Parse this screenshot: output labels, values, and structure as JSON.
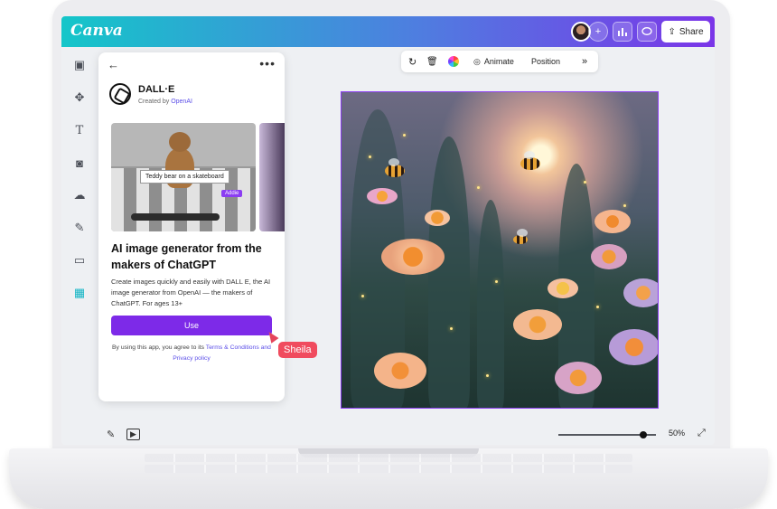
{
  "app": {
    "logo": "Canva"
  },
  "topbar": {
    "share_label": "Share",
    "buttons": [
      "add-icon",
      "analytics-icon",
      "comment-icon"
    ]
  },
  "context_toolbar": {
    "animate_label": "Animate",
    "position_label": "Position"
  },
  "panel": {
    "app_name": "DALL·E",
    "created_by_prefix": "Created by",
    "created_by_link": "OpenAI",
    "preview_caption": "Teddy bear on a skateboard",
    "preview_cursor_name": "Addie",
    "headline": "AI image generator from the makers of ChatGPT",
    "description": "Create images quickly and easily with DALL E, the AI image generator from OpenAI — the makers of ChatGPT. For ages 13+",
    "use_label": "Use",
    "terms_prefix": "By using this app, you agree to its",
    "terms_link": "Terms & Conditions and Privacy policy"
  },
  "collaborator": {
    "name": "Sheila"
  },
  "zoom": {
    "value": "50%",
    "level": 0.83
  },
  "colors": {
    "accent": "#7d2ae8",
    "topbar_start": "#14c6c9",
    "topbar_end": "#7b35e8",
    "collaborator": "#f04b5e"
  }
}
